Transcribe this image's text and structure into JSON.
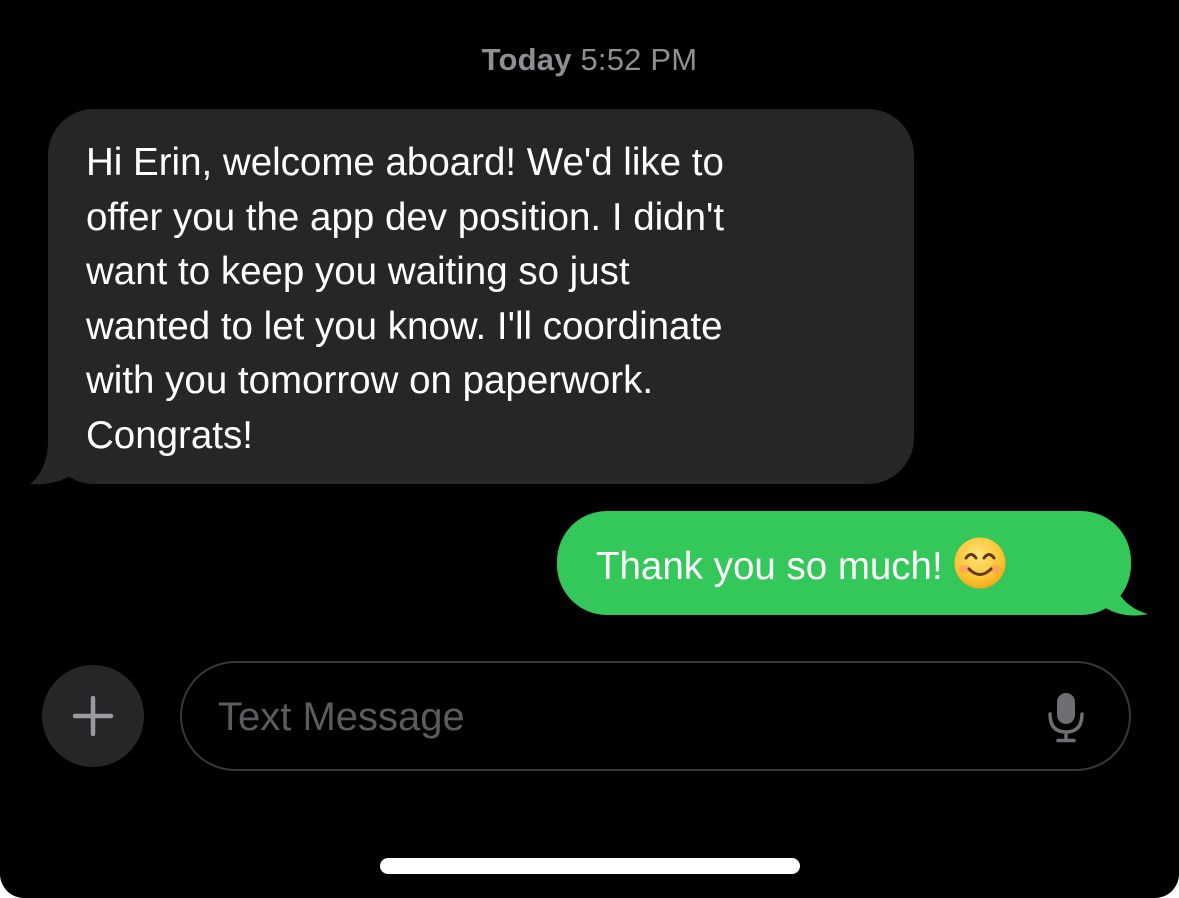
{
  "header": {
    "timestamp_day": "Today",
    "timestamp_time": "5:52 PM"
  },
  "messages": [
    {
      "direction": "incoming",
      "lines": [
        "Hi Erin, welcome aboard! We'd like to",
        "offer you the app dev position. I didn't",
        "want to keep you waiting so just",
        "wanted to let you know. I'll coordinate",
        "with you tomorrow on paperwork.",
        "Congrats!"
      ]
    },
    {
      "direction": "outgoing",
      "text": "Thank you so much!",
      "emoji": "smiling-face-icon"
    }
  ],
  "composer": {
    "placeholder": "Text Message",
    "value": "",
    "add_icon": "plus-icon",
    "mic_icon": "microphone-icon"
  },
  "colors": {
    "background": "#000000",
    "incoming_bubble": "#262628",
    "outgoing_bubble": "#34c759",
    "timestamp_text": "#8e8e93",
    "placeholder_text": "#5c5c60"
  }
}
